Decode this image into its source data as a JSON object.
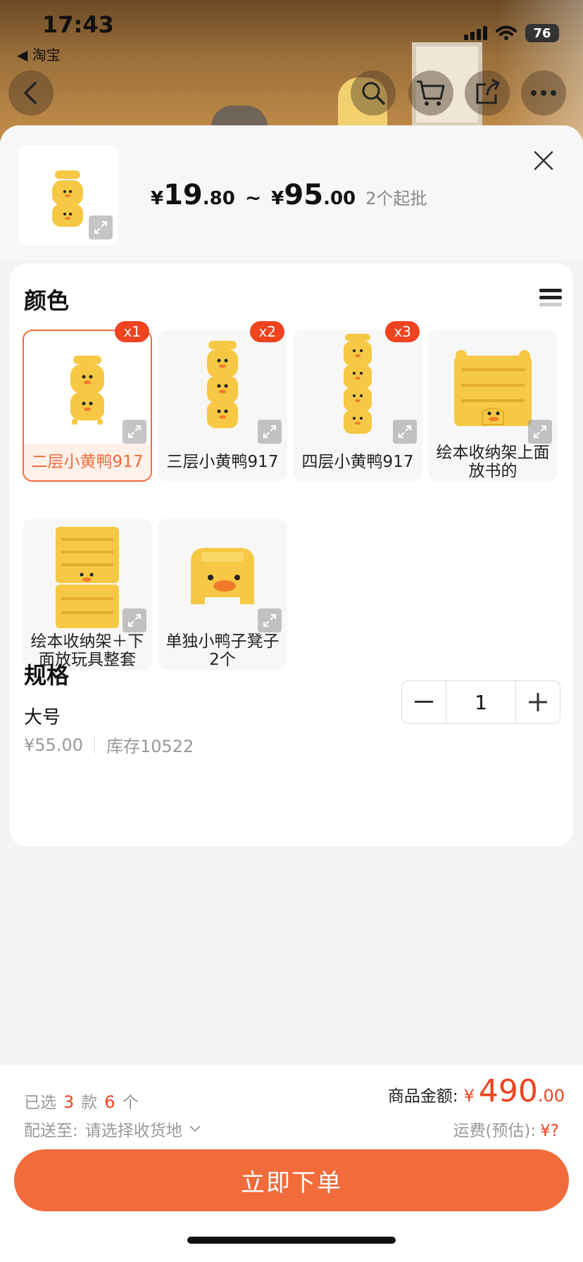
{
  "status_bar": {
    "time": "17:43",
    "back_app": "◀ 淘宝",
    "battery": "76"
  },
  "header": {
    "price_min_int": "19",
    "price_min_dec": ".80",
    "price_sep": "~",
    "price_max_int": "95",
    "price_max_dec": ".00",
    "currency": "¥",
    "moq": "2个起批"
  },
  "color_section": {
    "title": "颜色",
    "options": [
      {
        "label": "二层小黄鸭917",
        "badge": "x1",
        "selected": true
      },
      {
        "label": "三层小黄鸭917",
        "badge": "x2",
        "selected": false
      },
      {
        "label": "四层小黄鸭917",
        "badge": "x3",
        "selected": false
      },
      {
        "label": "绘本收纳架上面放书的",
        "badge": "",
        "selected": false
      },
      {
        "label": "绘本收纳架＋下面放玩具整套",
        "badge": "",
        "selected": false
      },
      {
        "label": "单独小鸭子凳子2个",
        "badge": "",
        "selected": false
      }
    ]
  },
  "spec_section": {
    "title": "规格",
    "name": "大号",
    "price": "¥55.00",
    "stock": "库存10522",
    "quantity": "1"
  },
  "footer": {
    "selected_prefix": "已选",
    "selected_styles": "3",
    "styles_unit": "款",
    "selected_count": "6",
    "count_unit": "个",
    "ship_label": "配送至:",
    "ship_value": "请选择收货地",
    "total_label": "商品金额:",
    "total_currency": "¥",
    "total_int": "490",
    "total_dec": ".00",
    "freight_label": "运费(预估):",
    "freight_value": "¥?",
    "order_button": "立即下单"
  },
  "colors": {
    "accent": "#f26b3a",
    "badge": "#f0431f",
    "duck": "#f6c843",
    "beak": "#f07a2a"
  }
}
